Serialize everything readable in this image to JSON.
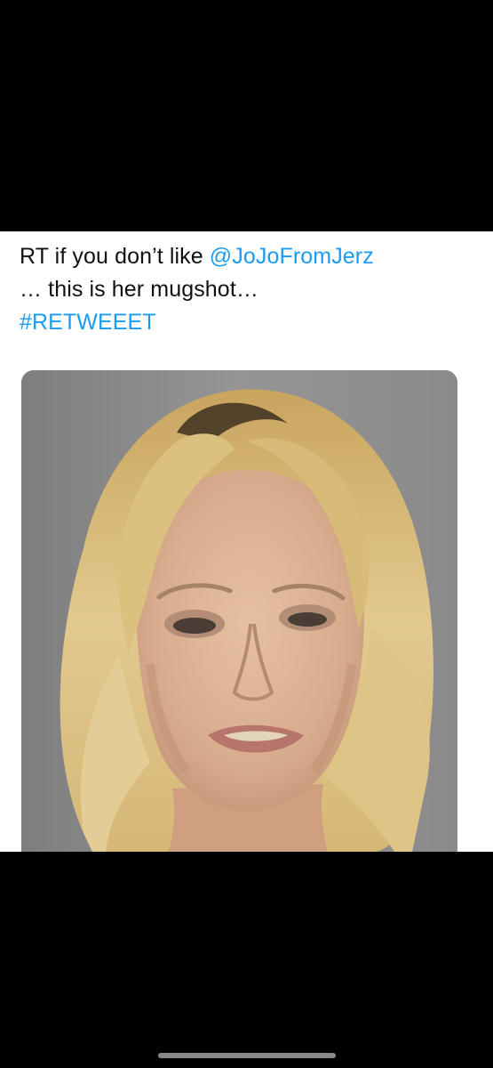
{
  "tweet": {
    "line1_prefix": "RT if you don’t like ",
    "mention": "@JoJoFromJerz",
    "line2": "… this is her mugshot…",
    "hashtag": "#RETWEEET",
    "link_color": "#1d9bf0"
  },
  "media": {
    "type": "photo"
  }
}
